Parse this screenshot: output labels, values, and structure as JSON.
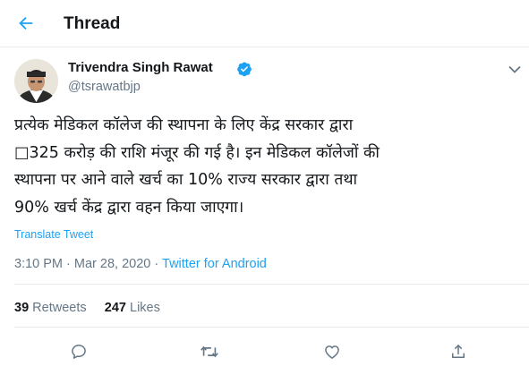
{
  "header": {
    "title": "Thread",
    "back_icon": "arrow-left-icon"
  },
  "tweet": {
    "author_name": "Trivendra Singh Rawat",
    "handle": "@tsrawatbjp",
    "verified_icon": "verified-badge-icon",
    "text": "प्रत्येक मेडिकल कॉलेज की स्थापना के लिए केंद्र सरकार द्वारा\n□325 करोड़ की राशि मंजूर की गई है। इन मेडिकल कॉलेजों की\nस्थापना पर आने वाले खर्च का 10% राज्य सरकार द्वारा तथा\n90% खर्च केंद्र द्वारा वहन किया जाएगा।",
    "translate_label": "Translate Tweet",
    "time": "3:10 PM",
    "separator": "·",
    "date": "Mar 28, 2020",
    "source": "Twitter for Android"
  },
  "stats": {
    "retweets_count": "39",
    "retweets_label": "Retweets",
    "likes_count": "247",
    "likes_label": "Likes"
  },
  "actions": [
    "reply-icon",
    "retweet-icon",
    "like-icon",
    "share-icon"
  ],
  "colors": {
    "accent": "#1da1f2",
    "secondary_text": "#657786",
    "primary_text": "#14171a",
    "divider": "#e6ecf0"
  }
}
